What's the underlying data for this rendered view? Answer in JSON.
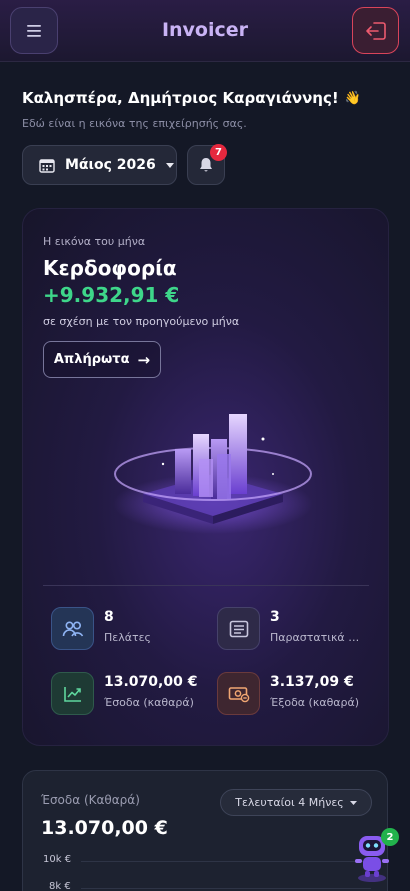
{
  "header": {
    "title": "Invoicer",
    "menu_icon": "hamburger-icon",
    "logout_icon": "logout-icon"
  },
  "greeting": {
    "text": "Καλησπέρα, Δημήτριος Καραγιάννης!",
    "emoji": "👋",
    "subtitle": "Εδώ είναι η εικόνα της επιχείρησής σας."
  },
  "period": {
    "month_label": "Μάιος 2026"
  },
  "notifications": {
    "count": "7"
  },
  "hero": {
    "label": "Η εικόνα του μήνα",
    "title": "Κερδοφορία",
    "value": "+9.932,91 €",
    "note": "σε σχέση με τον προηγούμενο μήνα",
    "unpaid_button": "Απλήρωτα",
    "unpaid_arrow": "→"
  },
  "stats": [
    {
      "value": "8",
      "label": "Πελάτες",
      "icon": "users-icon"
    },
    {
      "value": "3",
      "label": "Παραστατικά μήνα",
      "icon": "document-list-icon"
    },
    {
      "value": "13.070,00 €",
      "label": "Έσοδα (καθαρά)",
      "icon": "trend-up-icon"
    },
    {
      "value": "3.137,09 €",
      "label": "Έξοδα (καθαρά)",
      "icon": "money-out-icon"
    }
  ],
  "income_card": {
    "label": "Έσοδα (Καθαρά)",
    "value": "13.070,00 €",
    "period_select": "Τελευταίοι 4 Μήνες",
    "ticks": [
      "10k €",
      "8k €"
    ]
  },
  "assistant": {
    "badge": "2",
    "icon": "robot-assistant-icon"
  },
  "colors": {
    "accent": "#c9b3f5",
    "positive": "#3ed68a",
    "danger": "#d9445a",
    "badge_red": "#e5283e",
    "badge_green": "#22b24c"
  }
}
